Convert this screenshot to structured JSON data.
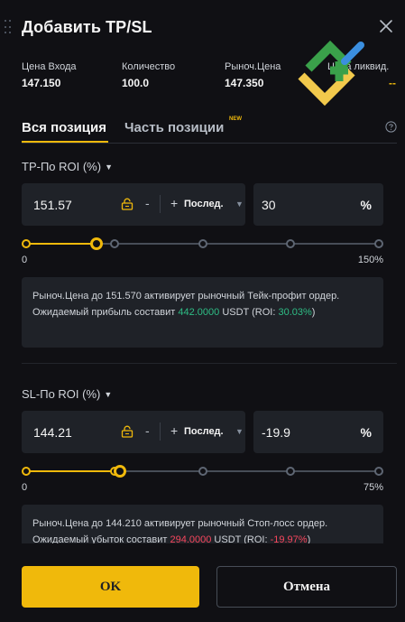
{
  "header": {
    "title": "Добавить TP/SL"
  },
  "summary": {
    "entry_price": {
      "label": "Цена Входа",
      "value": "147.150"
    },
    "quantity": {
      "label": "Количество",
      "value": "100.0"
    },
    "market_price": {
      "label": "Рыноч.Цена",
      "value": "147.350"
    },
    "liquidation": {
      "label": "Цена ликвид.",
      "value": "--"
    }
  },
  "tabs": [
    {
      "label": "Вся позиция",
      "active": true
    },
    {
      "label": "Часть позиции",
      "active": false,
      "badge": "NEW"
    }
  ],
  "tp": {
    "label": "TP-По ROI (%)",
    "price": "151.57",
    "minus": "-",
    "plus": "+",
    "price_type": "Послед.",
    "roi": "30",
    "percent": "%",
    "slider_min": "0",
    "slider_max": "150%",
    "slider_fraction": 0.2,
    "info": {
      "text1": "Рыноч.Цена до 151.570 активирует рыночный Тейк-профит ордер. Ожидаемый прибыль составит ",
      "amount": "442.0000",
      "text2": " USDT (ROI: ",
      "roi": "30.03%",
      "text3": ")"
    }
  },
  "sl": {
    "label": "SL-По ROI (%)",
    "price": "144.21",
    "minus": "-",
    "plus": "+",
    "price_type": "Послед.",
    "roi": "-19.9",
    "percent": "%",
    "slider_min": "0",
    "slider_max": "75%",
    "slider_fraction": 0.265,
    "info": {
      "text1": "Рыноч.Цена до 144.210 активирует рыночный Стоп-лосс ордер. Ожидаемый убыток составит ",
      "amount": "294.0000",
      "text2": " USDT (ROI: ",
      "roi": "-19.97%",
      "text3": ")"
    }
  },
  "footer": {
    "ok_label": "OK",
    "cancel_label": "Отмена"
  },
  "colors": {
    "accent": "#f0b90b",
    "profit": "#2ebd85",
    "loss": "#f6465d",
    "background": "#101014",
    "input_bg": "#1f2228"
  },
  "icons": [
    "drag-handle-icon",
    "close-icon",
    "watermark-logo",
    "help-icon",
    "lock-icon",
    "caret-down-icon"
  ]
}
